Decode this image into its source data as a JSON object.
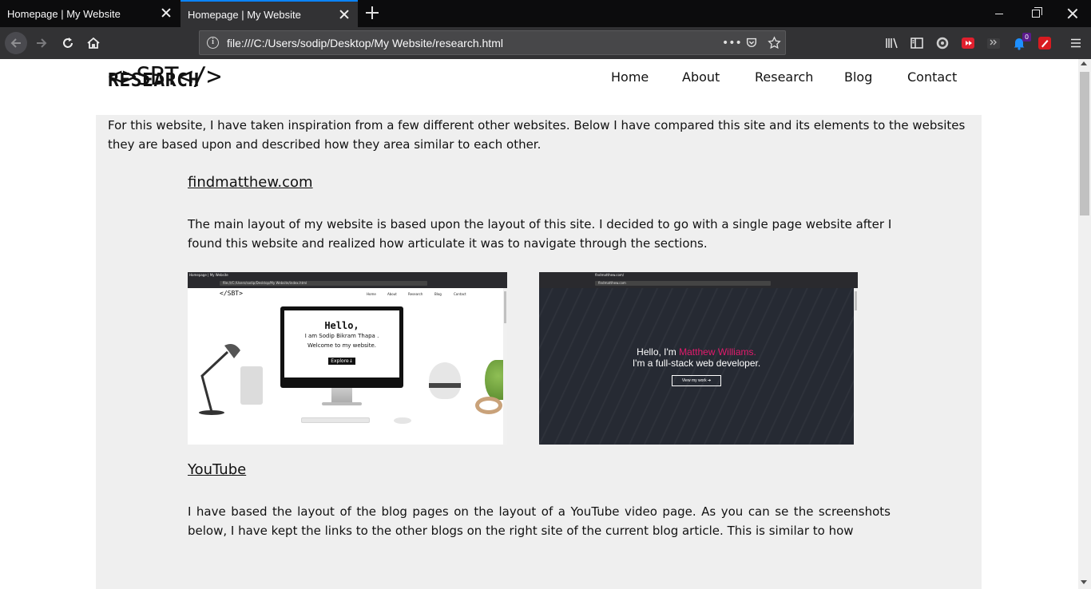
{
  "browser": {
    "tabs": [
      {
        "title": "Homepage | My Website",
        "active": false
      },
      {
        "title": "Homepage | My Website",
        "active": true
      }
    ],
    "url": "file:///C:/Users/sodip/Desktop/My Website/research.html",
    "accent": "#0a84ff",
    "notification_badge": "0"
  },
  "site": {
    "logo": "<>SBT</>",
    "nav": [
      "Home",
      "About",
      "Research",
      "Blog",
      "Contact"
    ]
  },
  "research": {
    "heading": "RESEARCH",
    "intro": "For this website, I have taken inspiration from a few different other websites. Below I have compared this site and its elements to the websites they are based upon and described how they area similar to each other.",
    "sections": [
      {
        "title": "findmatthew.com",
        "text": "The main layout of my website is based upon the layout of this site. I decided to go with a single page website after I found this website and realized how articulate it was to navigate through the sections."
      },
      {
        "title": "YouTube",
        "text": "I have based the layout of the blog pages on the layout of a YouTube video page. As you can se the screenshots below, I have kept the links to the other blogs on the right site of the current blog article. This is similar to how"
      }
    ]
  },
  "screenshot_own": {
    "tab": "Homepage | My Website",
    "url": "file:///C:/Users/sodip/Desktop/My Website/index.html",
    "logo": "</SBT>",
    "nav": [
      "Home",
      "About",
      "Research",
      "Blog",
      "Contact"
    ],
    "hello": "Hello,",
    "line1": "I am Sodip Bikram Thapa .",
    "line2": "Welcome to my website.",
    "button": "Explore↓"
  },
  "screenshot_findmatthew": {
    "tab": "findmatthew.com/",
    "url": "findmatthew.com",
    "greeting": "Hello, I'm ",
    "name": "Matthew Williams.",
    "line2": "I'm a full-stack web developer.",
    "button": "View my work  ➔",
    "name_color": "#e31b6d"
  }
}
